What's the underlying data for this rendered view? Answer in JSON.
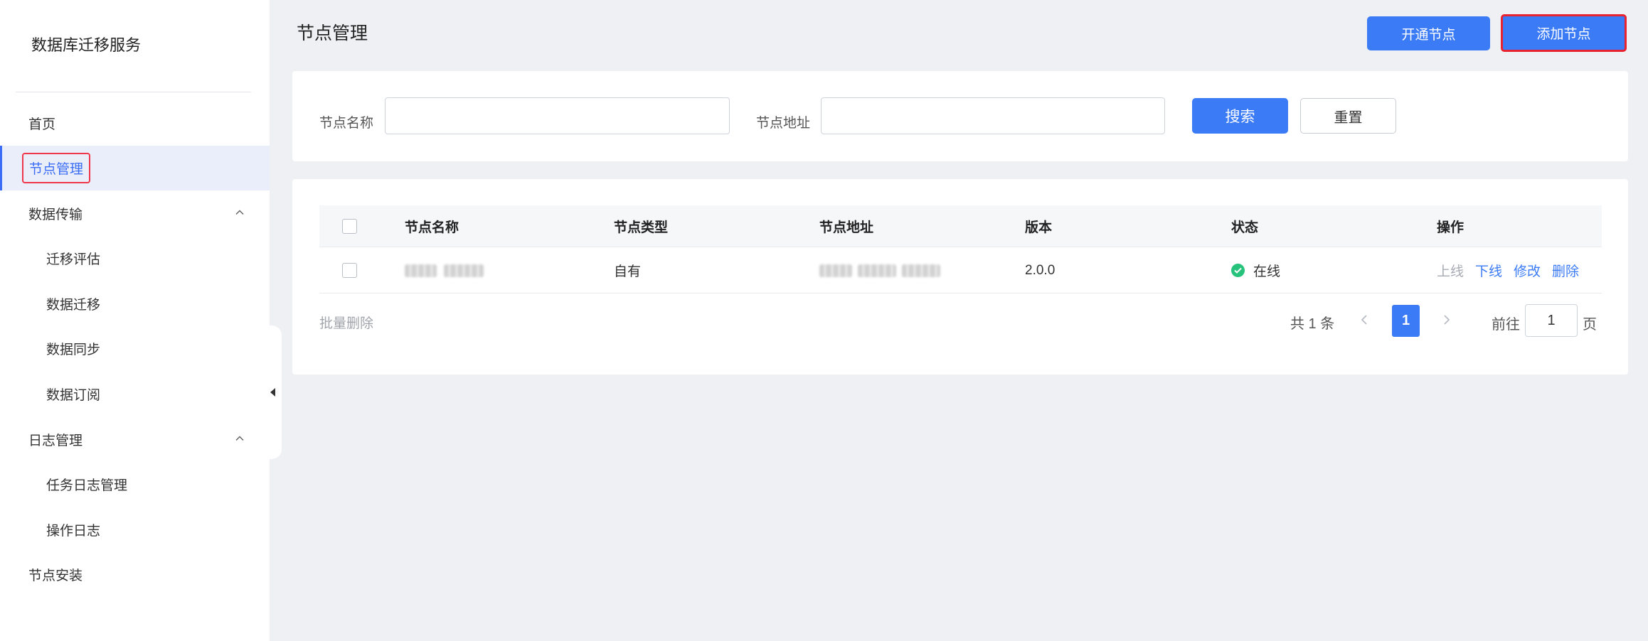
{
  "sidebar": {
    "brand": "数据库迁移服务",
    "items": [
      {
        "label": "首页"
      },
      {
        "label": "节点管理"
      },
      {
        "label": "数据传输"
      },
      {
        "label": "迁移评估"
      },
      {
        "label": "数据迁移"
      },
      {
        "label": "数据同步"
      },
      {
        "label": "数据订阅"
      },
      {
        "label": "日志管理"
      },
      {
        "label": "任务日志管理"
      },
      {
        "label": "操作日志"
      },
      {
        "label": "节点安装"
      }
    ]
  },
  "header": {
    "title": "节点管理",
    "open_node_label": "开通节点",
    "add_node_label": "添加节点"
  },
  "search": {
    "name_label": "节点名称",
    "name_value": "",
    "address_label": "节点地址",
    "address_value": "",
    "search_label": "搜索",
    "reset_label": "重置"
  },
  "table": {
    "columns": [
      "节点名称",
      "节点类型",
      "节点地址",
      "版本",
      "状态",
      "操作"
    ],
    "rows": [
      {
        "name": "",
        "type": "自有",
        "address": "",
        "version": "2.0.0",
        "status": "在线",
        "actions": [
          "上线",
          "下线",
          "修改",
          "删除"
        ]
      }
    ]
  },
  "footer": {
    "bulk_delete": "批量删除",
    "total": "共 1 条",
    "current_page": "1",
    "goto_prefix": "前往",
    "goto_value": "1",
    "goto_suffix": "页"
  },
  "colors": {
    "primary": "#3b7bf6",
    "highlight_border": "#e8222e",
    "online": "#27c27b"
  }
}
